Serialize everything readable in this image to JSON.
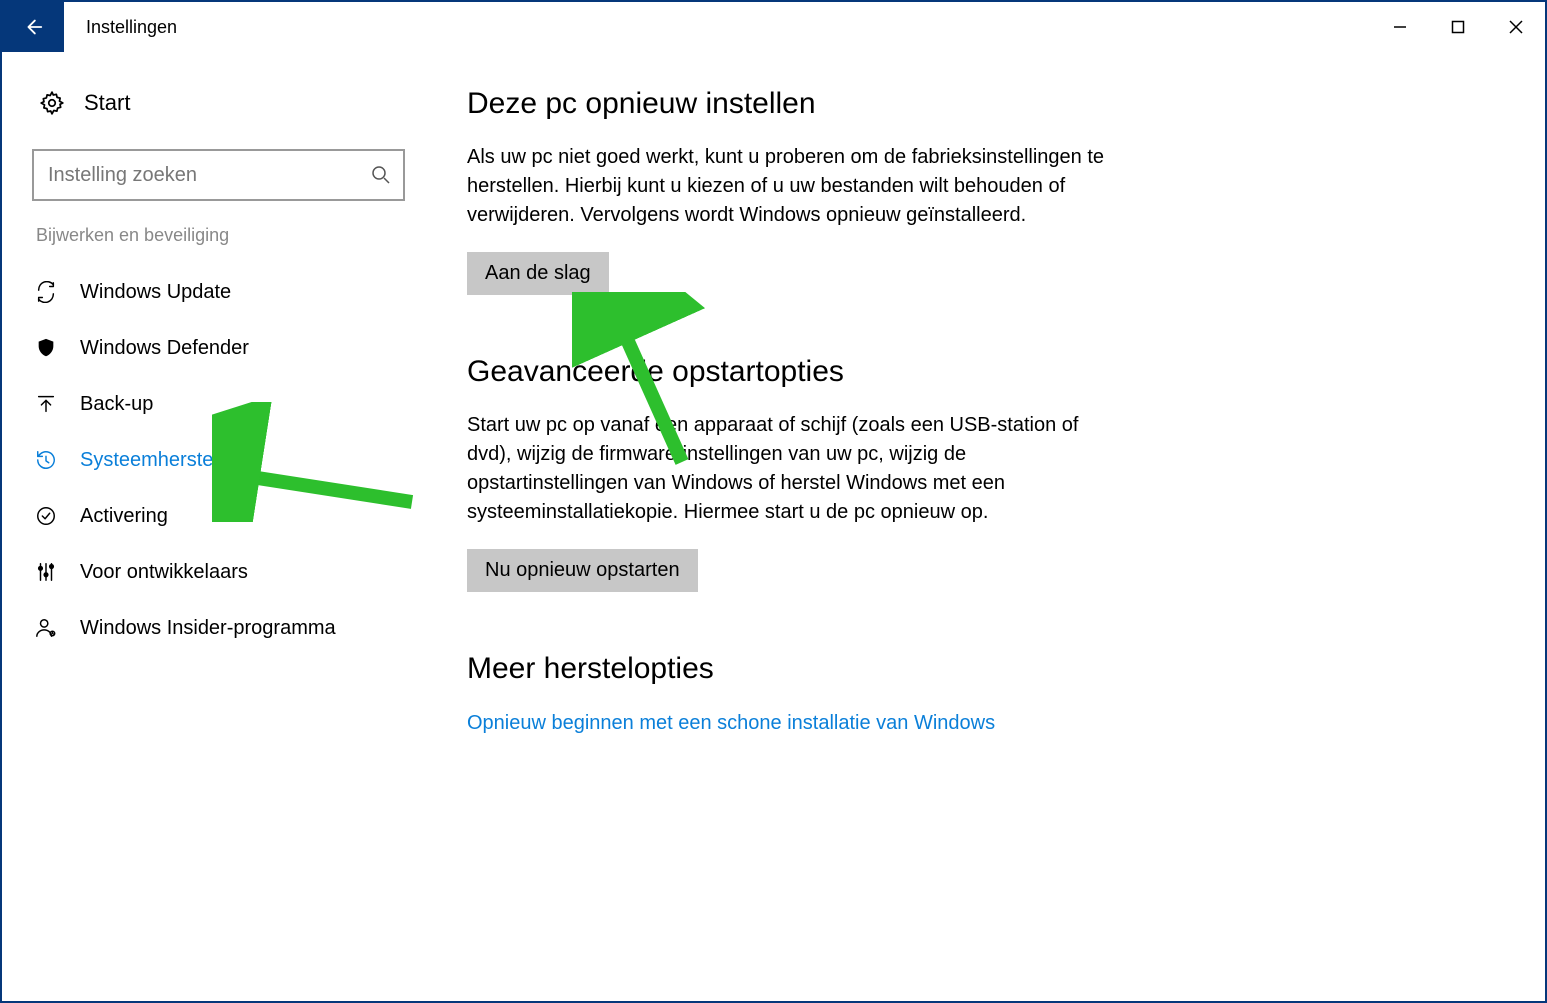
{
  "title": "Instellingen",
  "search": {
    "placeholder": "Instelling zoeken"
  },
  "home": {
    "label": "Start"
  },
  "group": {
    "title": "Bijwerken en beveiliging"
  },
  "nav": [
    {
      "label": "Windows Update"
    },
    {
      "label": "Windows Defender"
    },
    {
      "label": "Back-up"
    },
    {
      "label": "Systeemherstel"
    },
    {
      "label": "Activering"
    },
    {
      "label": "Voor ontwikkelaars"
    },
    {
      "label": "Windows Insider-programma"
    }
  ],
  "sections": [
    {
      "heading": "Deze pc opnieuw instellen",
      "body": "Als uw pc niet goed werkt, kunt u proberen om de fabrieksinstellingen te herstellen. Hierbij kunt u kiezen of u uw bestanden wilt behouden of verwijderen. Vervolgens wordt Windows opnieuw geïnstalleerd.",
      "button": "Aan de slag"
    },
    {
      "heading": "Geavanceerde opstartopties",
      "body": "Start uw pc op vanaf een apparaat of schijf (zoals een USB-station of dvd), wijzig de firmware-instellingen van uw pc, wijzig de opstartinstellingen van Windows of herstel Windows met een systeeminstallatiekopie. Hiermee start u de pc opnieuw op.",
      "button": "Nu opnieuw opstarten"
    },
    {
      "heading": "Meer herstelopties",
      "link": "Opnieuw beginnen met een schone installatie van Windows"
    }
  ]
}
